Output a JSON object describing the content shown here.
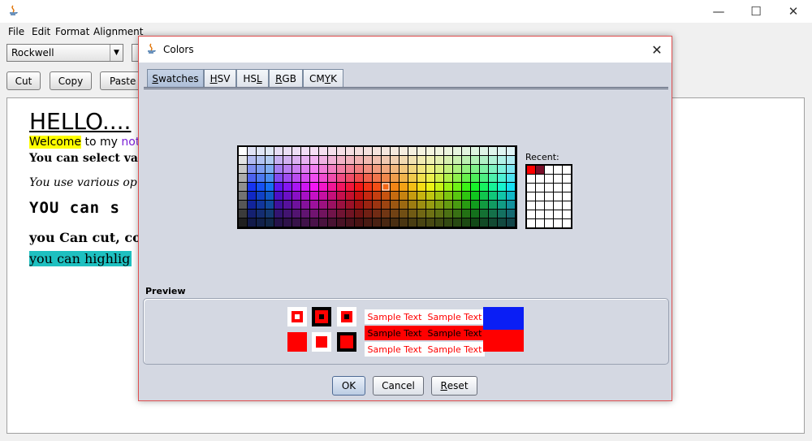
{
  "window": {
    "title": "",
    "menu": [
      "File",
      "Edit",
      "Format",
      "Alignment"
    ],
    "font_combo_value": "Rockwell",
    "buttons": {
      "cut": "Cut",
      "copy": "Copy",
      "paste": "Paste"
    },
    "controls": {
      "minimize": "—",
      "maximize": "☐",
      "close": "✕"
    }
  },
  "editor": {
    "hello": "HELLO....",
    "welcome_highlight": "Welcome",
    "welcome_mid": " to my ",
    "welcome_purple": "note",
    "select_line": "You can select var",
    "various_line": "You use various op",
    "youcan_line": "YOU can s",
    "cut_line": "you Can cut, co",
    "highlight_line": "you can highlig",
    "highlight_color": "#1ec0c0",
    "welcome_bg": "#ffff00"
  },
  "dialog": {
    "title": "Colors",
    "close_glyph": "✕",
    "tabs": [
      {
        "pre": "",
        "u": "S",
        "post": "watches",
        "active": true
      },
      {
        "pre": "",
        "u": "H",
        "post": "SV",
        "active": false
      },
      {
        "pre": "HS",
        "u": "L",
        "post": "",
        "active": false
      },
      {
        "pre": "",
        "u": "R",
        "post": "GB",
        "active": false
      },
      {
        "pre": "CM",
        "u": "Y",
        "post": "K",
        "active": false
      }
    ],
    "recent_label": "Recent:",
    "recent_colors": [
      "#ff0000",
      "#7a0f2a"
    ],
    "preview_label": "Preview",
    "sample_text": "Sample Text",
    "selected_color": "#ff0000",
    "preview_top_right_color": "#0a1ef5",
    "buttons": {
      "ok": "OK",
      "cancel": "Cancel",
      "reset_u": "R",
      "reset_rest": "eset"
    }
  }
}
